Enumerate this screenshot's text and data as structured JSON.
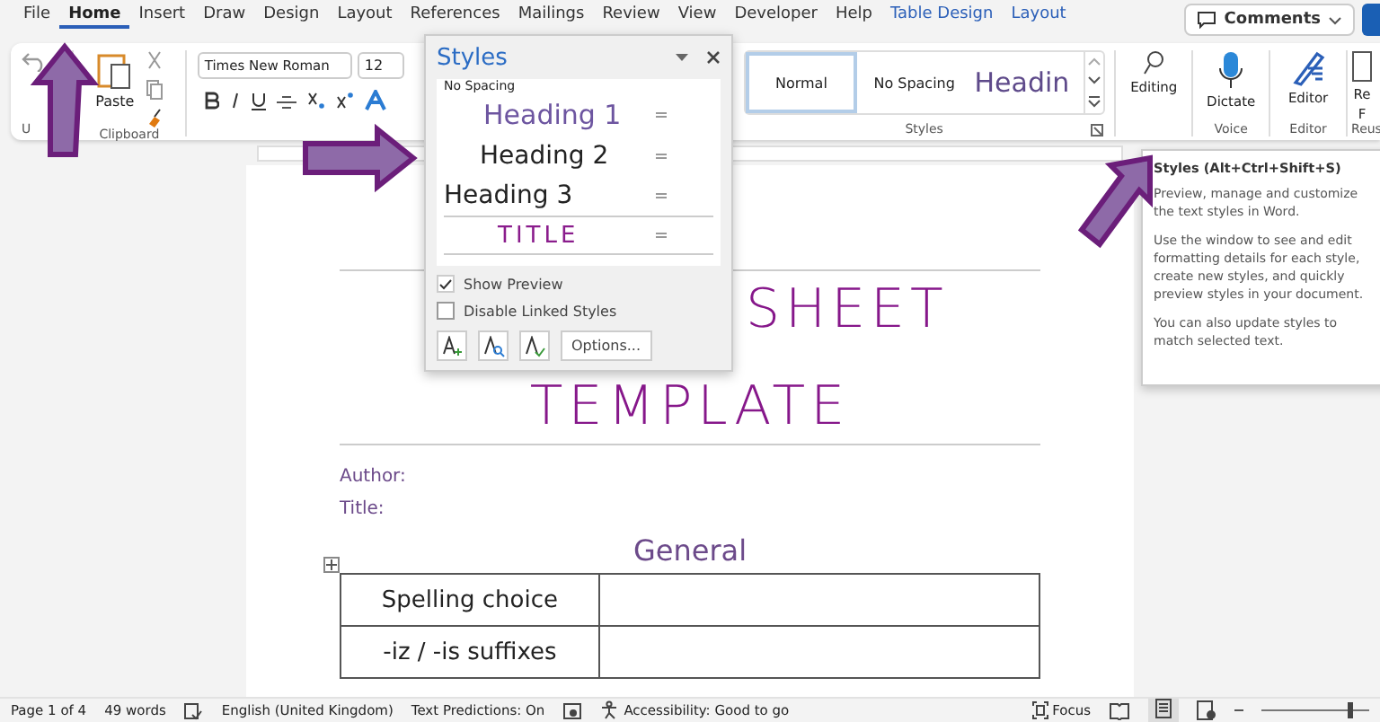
{
  "menu_tabs": [
    {
      "label": "File",
      "selected": false,
      "contextual": false
    },
    {
      "label": "Home",
      "selected": true,
      "contextual": false
    },
    {
      "label": "Insert",
      "selected": false,
      "contextual": false
    },
    {
      "label": "Draw",
      "selected": false,
      "contextual": false
    },
    {
      "label": "Design",
      "selected": false,
      "contextual": false
    },
    {
      "label": "Layout",
      "selected": false,
      "contextual": false
    },
    {
      "label": "References",
      "selected": false,
      "contextual": false
    },
    {
      "label": "Mailings",
      "selected": false,
      "contextual": false
    },
    {
      "label": "Review",
      "selected": false,
      "contextual": false
    },
    {
      "label": "View",
      "selected": false,
      "contextual": false
    },
    {
      "label": "Developer",
      "selected": false,
      "contextual": false
    },
    {
      "label": "Help",
      "selected": false,
      "contextual": false
    },
    {
      "label": "Table Design",
      "selected": false,
      "contextual": true
    },
    {
      "label": "Layout",
      "selected": false,
      "contextual": true
    }
  ],
  "comments_button": "Comments",
  "ribbon": {
    "undo_group_label": "U",
    "clipboard": {
      "paste": "Paste",
      "label": "Clipboard"
    },
    "font": {
      "name": "Times New Roman",
      "size": "12"
    },
    "styles_gallery": [
      {
        "label": "Normal",
        "selected": true,
        "kind": "normal"
      },
      {
        "label": "No Spacing",
        "selected": false,
        "kind": "normal"
      },
      {
        "label": "Headin",
        "selected": false,
        "kind": "heading"
      }
    ],
    "styles_label": "Styles",
    "editing": "Editing",
    "dictate": "Dictate",
    "voice_label": "Voice",
    "editor": "Editor",
    "editor_label": "Editor",
    "reuse": "Re",
    "reuse_line2": "F",
    "reuse_label": "Reus"
  },
  "styles_pane": {
    "title": "Styles",
    "items": [
      {
        "label": "No Spacing",
        "kind": "cut"
      },
      {
        "label": "Heading 1",
        "kind": "h1"
      },
      {
        "label": "Heading 2",
        "kind": "h2"
      },
      {
        "label": "Heading 3",
        "kind": "h3"
      },
      {
        "label": "TITLE",
        "kind": "title"
      }
    ],
    "options": [
      {
        "label": "Show Preview",
        "checked": true
      },
      {
        "label": "Disable Linked Styles",
        "checked": false
      }
    ],
    "options_button": "Options..."
  },
  "tooltip": {
    "title": "Styles (Alt+Ctrl+Shift+S)",
    "paragraphs": [
      "Preview, manage and customize the text styles in Word.",
      "Use the window to see and edit formatting details for each style, create new styles, and quickly preview styles in your document.",
      "You can also update styles to match selected text."
    ]
  },
  "document": {
    "title_lines": [
      "SHEET",
      "TEMPLATE"
    ],
    "fields": [
      "Author:",
      "Title:"
    ],
    "section_heading": "General",
    "table_rows": [
      [
        "Spelling choice",
        ""
      ],
      [
        "-iz / -is suffixes",
        ""
      ]
    ]
  },
  "status_bar": {
    "page": "Page 1 of 4",
    "words": "49 words",
    "language": "English (United Kingdom)",
    "predictions": "Text Predictions: On",
    "accessibility": "Accessibility: Good to go",
    "focus": "Focus",
    "zoom": {
      "level": 0.8
    }
  }
}
